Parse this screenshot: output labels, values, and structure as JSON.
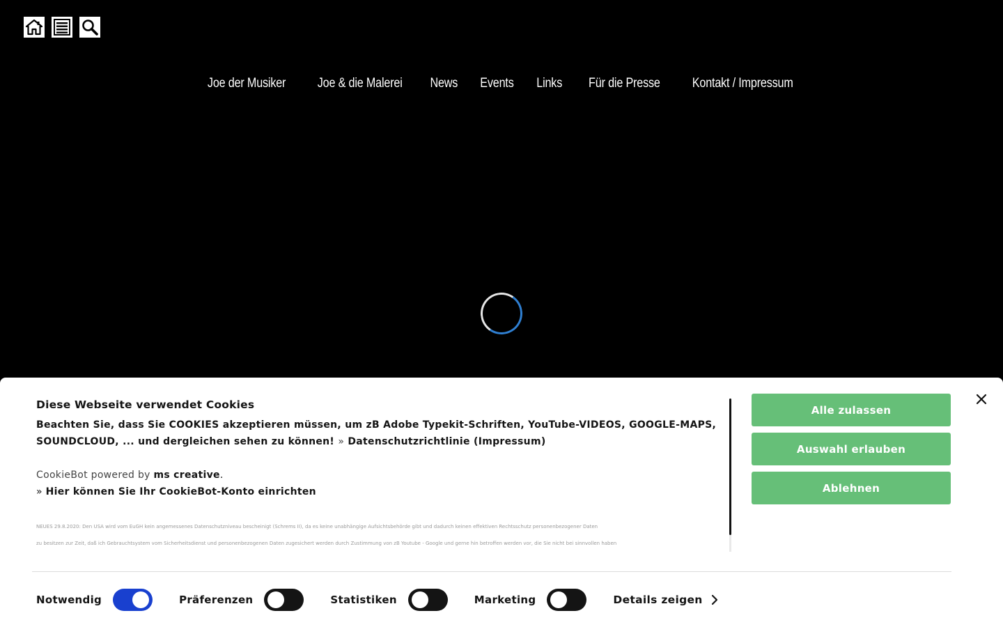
{
  "icons": {
    "home": "home-icon",
    "menu": "menu-icon",
    "search": "search-icon"
  },
  "nav": [
    {
      "label": "Joe der Musiker"
    },
    {
      "label": "Joe & die Malerei"
    },
    {
      "label": "News"
    },
    {
      "label": "Events"
    },
    {
      "label": "Links"
    },
    {
      "label": "Für die Presse"
    },
    {
      "label": "Kontakt / Impressum"
    }
  ],
  "cookie": {
    "title": "Diese Webseite verwendet Cookies",
    "message": "Beachten Sie, dass Sie COOKIES akzeptieren müssen, um zB Adobe Typekit-Schriften, YouTube-VIDEOS, GOOGLE-MAPS, SOUNDCLOUD, ... und dergleichen sehen zu können!",
    "arrow": "»",
    "privacy_link": "Datenschutzrichtlinie (Impressum)",
    "powered_by": "CookieBot powered by",
    "powered_by_link": "ms creative",
    "powered_by_dot": ".",
    "account_link": "Hier können Sie Ihr CookieBot-Konto einrichten",
    "small_text_1": "NEUES 29.8.2020: Den USA wird vom EuGH kein angemessenes Datenschutzniveau bescheinigt (Schrems II), da es keine unabhängige Aufsichtsbehörde gibt und dadurch keinen effektiven Rechtsschutz personenbezogener Daten",
    "small_text_2": "zu besitzen zur Zeit, daß ich Gebrauchtsystem vom Sicherheitsdienst und personenbezogenen Daten zugesichert werden durch Zustimmung von zB Youtube - Google und gerne hin betroffen werden vor, die Sie nicht bei sinnvollen haben",
    "buttons": {
      "allow_all": "Alle zulassen",
      "allow_selection": "Auswahl erlauben",
      "deny": "Ablehnen"
    },
    "toggles": [
      {
        "label": "Notwendig",
        "on": true
      },
      {
        "label": "Präferenzen",
        "on": false
      },
      {
        "label": "Statistiken",
        "on": false
      },
      {
        "label": "Marketing",
        "on": false
      }
    ],
    "details_label": "Details zeigen"
  },
  "colors": {
    "accept_green": "#66bf78",
    "toggle_on_blue": "#1940cf",
    "spinner_blue": "#2f7fd1"
  }
}
